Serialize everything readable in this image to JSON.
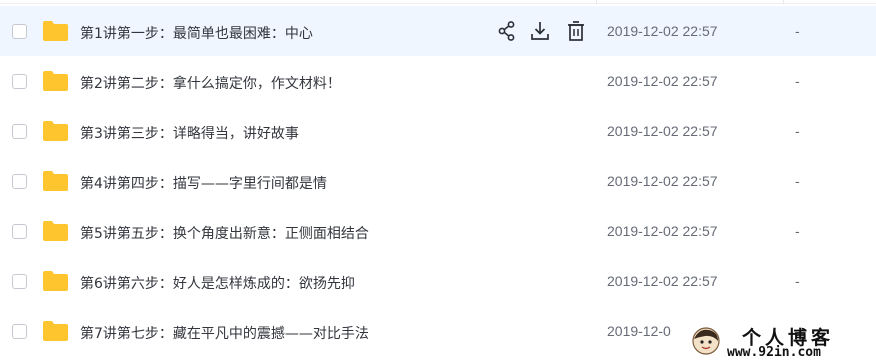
{
  "rows": [
    {
      "name": "第1讲第一步：最简单也最困难：中心",
      "time": "2019-12-02 22:57",
      "size": "-",
      "hovered": true
    },
    {
      "name": "第2讲第二步：拿什么搞定你，作文材料！",
      "time": "2019-12-02 22:57",
      "size": "-"
    },
    {
      "name": "第3讲第三步：详略得当，讲好故事",
      "time": "2019-12-02 22:57",
      "size": "-"
    },
    {
      "name": "第4讲第四步：描写——字里行间都是情",
      "time": "2019-12-02 22:57",
      "size": "-"
    },
    {
      "name": "第5讲第五步：换个角度出新意：正侧面相结合",
      "time": "2019-12-02 22:57",
      "size": "-"
    },
    {
      "name": "第6讲第六步：好人是怎样炼成的：欲扬先抑",
      "time": "2019-12-02 22:57",
      "size": "-"
    },
    {
      "name": "第7讲第七步：藏在平凡中的震撼——对比手法",
      "time": "2019-12-0",
      "size": "-"
    }
  ],
  "row_actions": {
    "share_icon": "share-icon",
    "download_icon": "download-icon",
    "delete_icon": "trash-icon"
  },
  "watermark": {
    "title": "个人博客",
    "url": "www.92in.com"
  },
  "colors": {
    "folder": "#FFC52E",
    "hover_row": "#F0F6FF",
    "text": "#33363D",
    "muted": "#666B76"
  }
}
